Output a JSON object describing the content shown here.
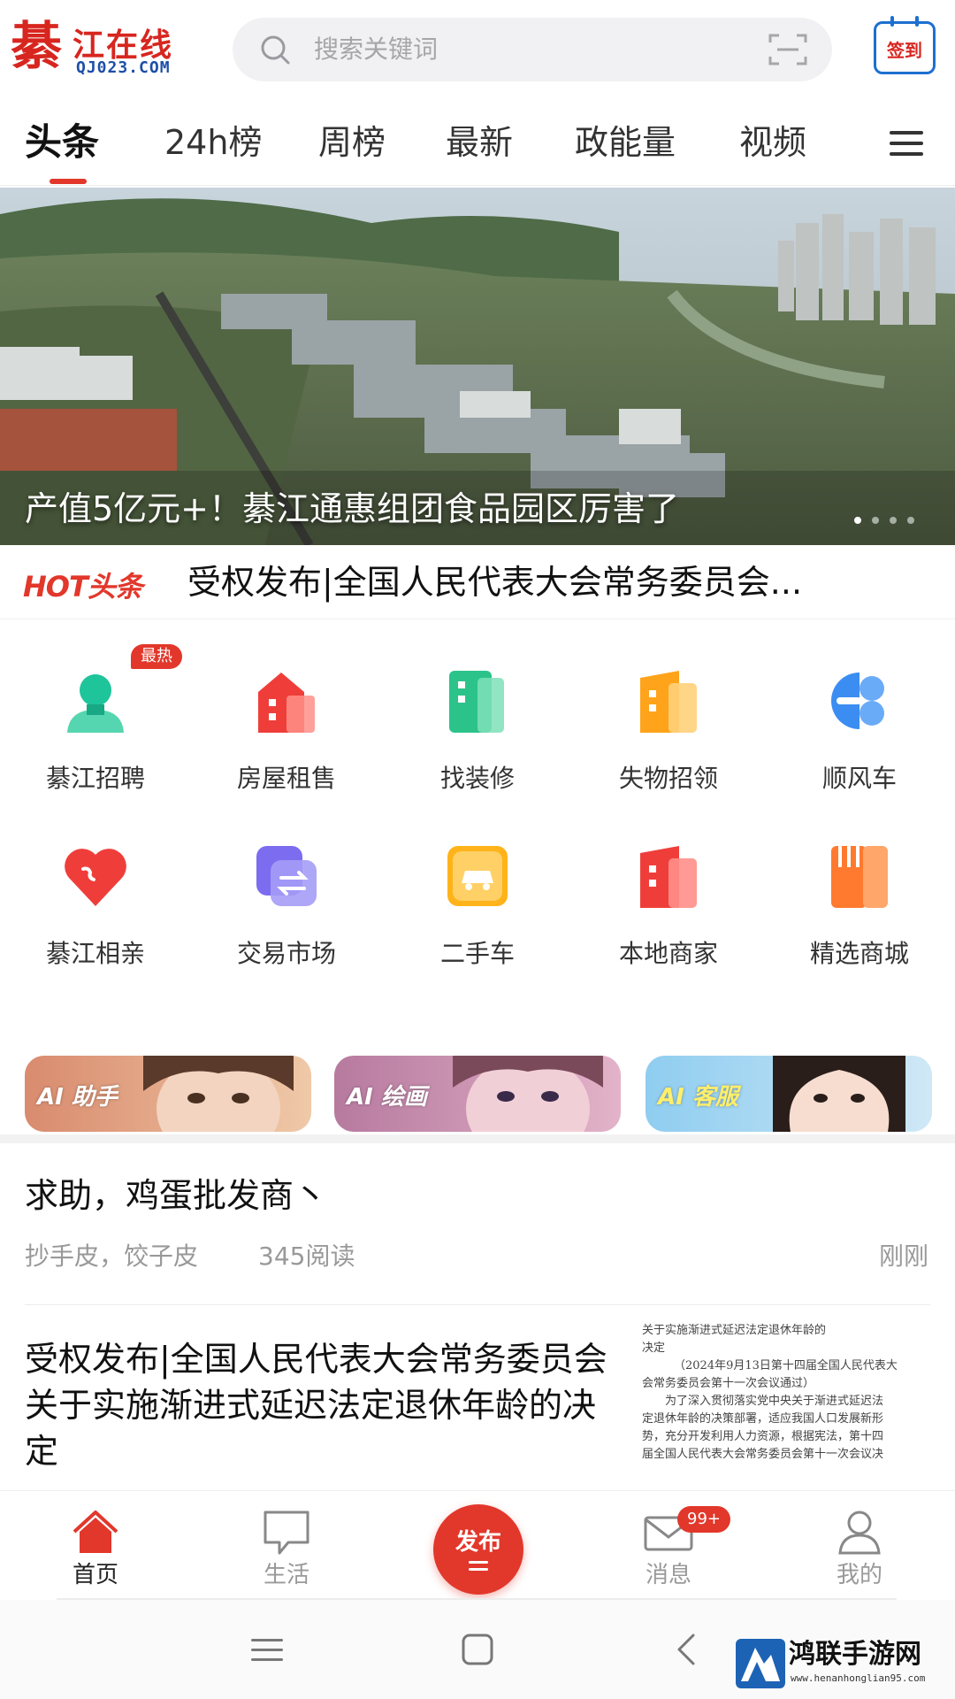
{
  "header": {
    "logo_big": "綦",
    "logo_name": "江在线",
    "logo_domain": "QJ023.COM",
    "search_placeholder": "搜索关键词",
    "checkin_label": "签到"
  },
  "tabs": [
    {
      "label": "头条",
      "active": true
    },
    {
      "label": "24h榜",
      "active": false
    },
    {
      "label": "周榜",
      "active": false
    },
    {
      "label": "最新",
      "active": false
    },
    {
      "label": "政能量",
      "active": false
    },
    {
      "label": "视频",
      "active": false
    }
  ],
  "banner": {
    "title": "产值5亿元+！綦江通惠组团食品园区厉害了",
    "dots": 4,
    "active_dot": 0
  },
  "hot": {
    "badge": "HOT头条",
    "text": "受权发布|全国人民代表大会常务委员会..."
  },
  "grid": [
    {
      "label": "綦江招聘",
      "icon": "person-icon",
      "color": "#1ec49a"
    },
    {
      "label": "房屋租售",
      "icon": "house-icon",
      "color": "#ef3e3a"
    },
    {
      "label": "找装修",
      "icon": "building-icon",
      "color": "#2cc38a"
    },
    {
      "label": "失物招领",
      "icon": "box-icon",
      "color": "#ffa31a"
    },
    {
      "label": "顺风车",
      "icon": "car-share-icon",
      "color": "#3b8df2"
    },
    {
      "label": "綦江相亲",
      "icon": "heart-icon",
      "color": "#ef3e3a"
    },
    {
      "label": "交易市场",
      "icon": "exchange-icon",
      "color": "#7b6cf0"
    },
    {
      "label": "二手车",
      "icon": "car-icon",
      "color": "#ffb31a"
    },
    {
      "label": "本地商家",
      "icon": "shop-icon",
      "color": "#ef3e3a"
    },
    {
      "label": "精选商城",
      "icon": "cutlery-icon",
      "color": "#ff7a2f"
    }
  ],
  "grid_hot_tag": "最热",
  "ai_cards": [
    {
      "label": "AI 助手",
      "color": "#c96f5a"
    },
    {
      "label": "AI 绘画",
      "color": "#b06e95"
    },
    {
      "label": "AI 客服",
      "color": "#7ec0e8"
    }
  ],
  "posts": [
    {
      "title": "求助，鸡蛋批发商丶",
      "meta": "抄手皮，饺子皮",
      "views": "345阅读",
      "time": "刚刚"
    },
    {
      "title": "受权发布|全国人民代表大会常务委员会关于实施渐进式延迟法定退休年龄的决定",
      "thumb_lines": [
        "关于实施渐进式延迟法定退休年龄的",
        "决定",
        "（2024年9月13日第十四届全国人民代表大",
        "会常务委员会第十一次会议通过）",
        "为了深入贯彻落实党中央关于渐进式延迟法",
        "定退休年龄的决策部署，适应我国人口发展新形",
        "势，充分开发利用人力资源，根据宪法，第十四",
        "届全国人民代表大会常务委员会第十一次会议决"
      ]
    }
  ],
  "bottom_nav": [
    {
      "label": "首页",
      "icon": "home-icon",
      "active": true
    },
    {
      "label": "生活",
      "icon": "chat-icon",
      "active": false
    },
    {
      "label": "发布",
      "icon": "publish-icon",
      "active": false
    },
    {
      "label": "消息",
      "icon": "mail-icon",
      "active": false
    },
    {
      "label": "我的",
      "icon": "user-icon",
      "active": false
    }
  ],
  "message_badge": "99+",
  "watermark": {
    "name": "鸿联手游网",
    "url": "www.henanhonglian95.com"
  }
}
